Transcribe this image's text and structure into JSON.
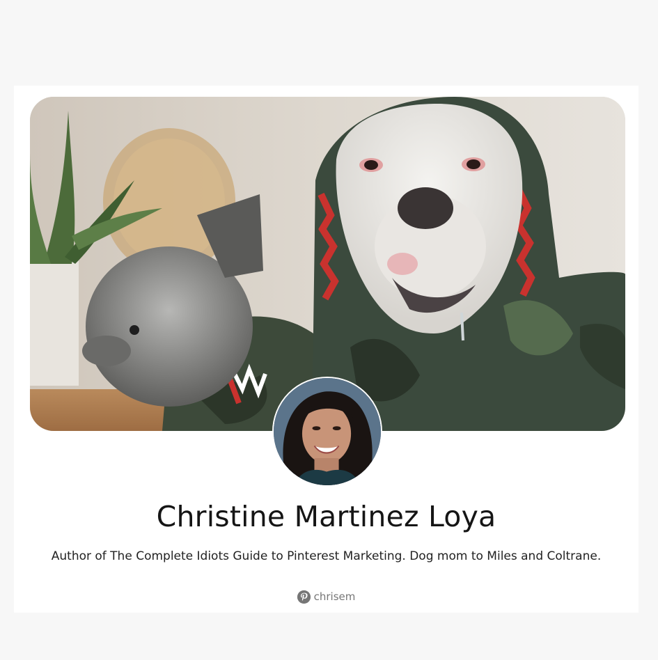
{
  "profile": {
    "name": "Christine Martinez Loya",
    "bio": "Author of The Complete Idiots Guide to Pinterest Marketing. Dog mom to Miles and Coltrane.",
    "handle": "chrisem",
    "handle_icon": "pinterest-icon"
  },
  "colors": {
    "page_background": "#f7f7f7",
    "card_background": "#ffffff",
    "name_text": "#151515",
    "muted_text": "#767676"
  }
}
